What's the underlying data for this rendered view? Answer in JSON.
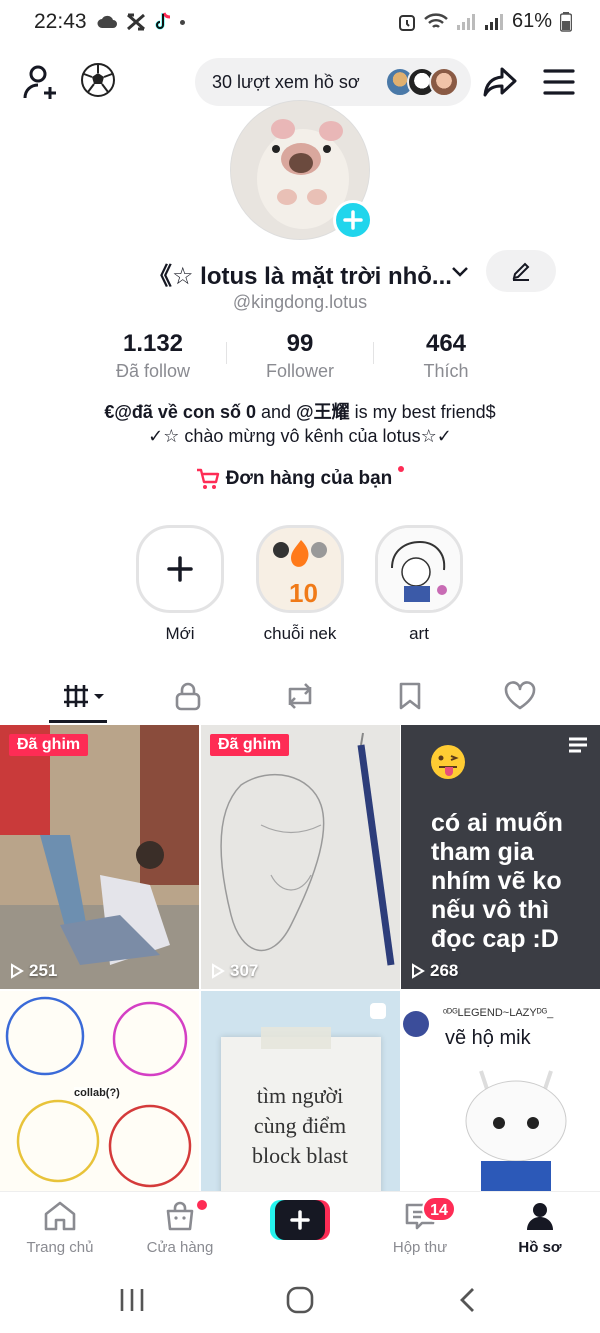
{
  "status_bar": {
    "time": "22:43",
    "battery": "61%"
  },
  "header": {
    "views_text": "30 lượt xem hồ sơ"
  },
  "profile": {
    "name": "《☆ lotus là mặt trời nhỏ...",
    "handle": "@kingdong.lotus",
    "stats": [
      {
        "value": "1.132",
        "label": "Đã follow"
      },
      {
        "value": "99",
        "label": "Follower"
      },
      {
        "value": "464",
        "label": "Thích"
      }
    ],
    "bio_line1_prefix": "€@đã về con số 0",
    "bio_line1_and": " and ",
    "bio_line1_mention": "@王耀",
    "bio_line1_suffix": " is my best friend$",
    "bio_line2": "✓☆ chào mừng vô kênh của lotus☆✓",
    "orders_label": "Đơn hàng của bạn"
  },
  "highlights": [
    {
      "label": "Mới"
    },
    {
      "label": "chuỗi nek"
    },
    {
      "label": "art"
    }
  ],
  "videos": [
    {
      "pinned": "Đã ghim",
      "plays": "251"
    },
    {
      "pinned": "Đã ghim",
      "plays": "307"
    },
    {
      "caption": "có ai muốn tham gia nhím vẽ ko nếu vô thì đọc cap :D",
      "plays": "268"
    },
    {
      "caption": "collab(?)"
    },
    {
      "caption": "tìm người cùng điểm block blast"
    },
    {
      "caption": "vẽ hộ mik",
      "author": "ᵒᴰᴳLEGEND~LAZYᴰᴳ_"
    }
  ],
  "bottom_nav": {
    "home": "Trang chủ",
    "shop": "Cửa hàng",
    "inbox": "Hộp thư",
    "inbox_badge": "14",
    "profile": "Hồ sơ"
  },
  "colors": {
    "accent": "#fe2c55",
    "cyan": "#20d5ec",
    "text": "#161823",
    "muted": "#8a8b91"
  }
}
